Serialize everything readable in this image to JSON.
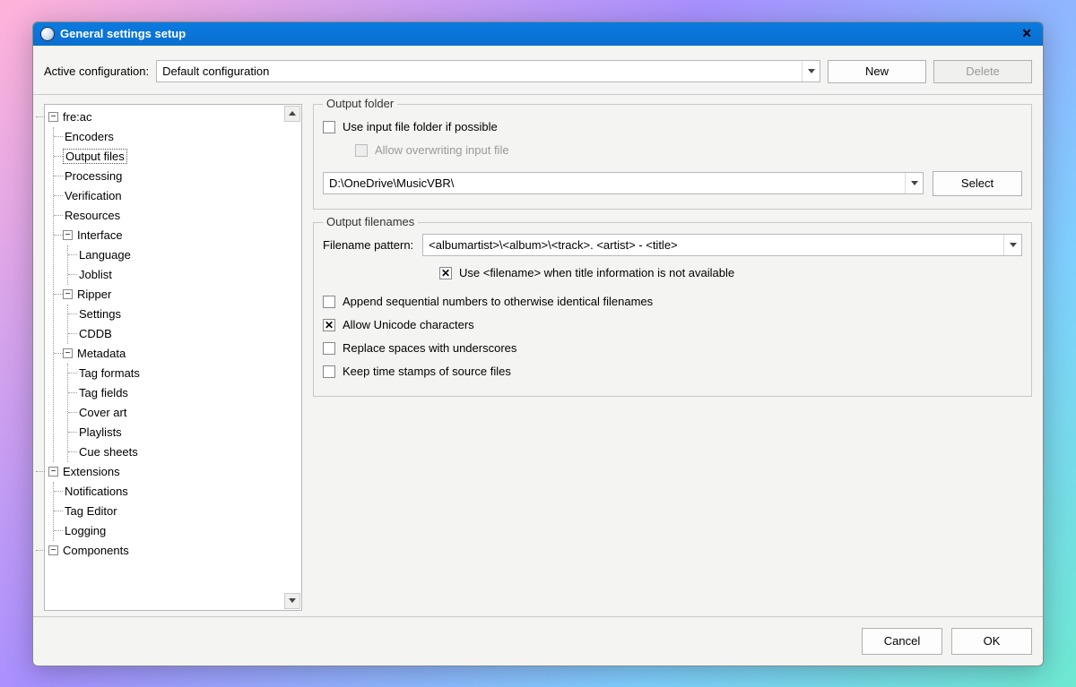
{
  "window": {
    "title": "General settings setup"
  },
  "config": {
    "label": "Active configuration:",
    "value": "Default configuration",
    "new_btn": "New",
    "delete_btn": "Delete"
  },
  "tree": {
    "root": "fre:ac",
    "encoders": "Encoders",
    "output_files": "Output files",
    "processing": "Processing",
    "verification": "Verification",
    "resources": "Resources",
    "interface": "Interface",
    "language": "Language",
    "joblist": "Joblist",
    "ripper": "Ripper",
    "settings": "Settings",
    "cddb": "CDDB",
    "metadata": "Metadata",
    "tag_formats": "Tag formats",
    "tag_fields": "Tag fields",
    "cover_art": "Cover art",
    "playlists": "Playlists",
    "cue_sheets": "Cue sheets",
    "extensions": "Extensions",
    "notifications": "Notifications",
    "tag_editor": "Tag Editor",
    "logging": "Logging",
    "components": "Components"
  },
  "output_folder": {
    "legend": "Output folder",
    "use_input": "Use input file folder if possible",
    "allow_overwrite": "Allow overwriting input file",
    "path": "D:\\OneDrive\\MusicVBR\\",
    "select_btn": "Select"
  },
  "output_filenames": {
    "legend": "Output filenames",
    "pattern_label": "Filename pattern:",
    "pattern_value": "<albumartist>\\<album>\\<track>. <artist> - <title>",
    "use_filename": "Use <filename> when title information is not available",
    "append_seq": "Append sequential numbers to otherwise identical filenames",
    "allow_unicode": "Allow Unicode characters",
    "replace_spaces": "Replace spaces with underscores",
    "keep_timestamps": "Keep time stamps of source files"
  },
  "footer": {
    "cancel": "Cancel",
    "ok": "OK"
  }
}
